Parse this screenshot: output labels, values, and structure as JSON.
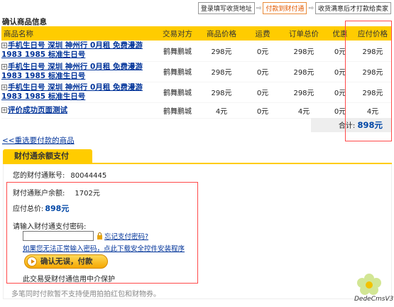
{
  "steps": [
    "登录填写收货地址",
    "付款到财付通",
    "收货满意后才打款给卖家"
  ],
  "step_arrow": "⇨",
  "page_title": "确认商品信息",
  "table": {
    "headers": [
      "商品名称",
      "交易对方",
      "商品价格",
      "运费",
      "订单总价",
      "优惠",
      "应付价格"
    ],
    "rows": [
      {
        "name": "手机生日号 深圳 神州行 0月租 免费漫游 1983 1985 标准生日号",
        "seller": "鹤舞鹏城",
        "price": "298元",
        "shipping": "0元",
        "total": "298元",
        "discount": "0元",
        "due": "298元"
      },
      {
        "name": "手机生日号 深圳 神州行 0月租 免费漫游 1983 1985 标准生日号",
        "seller": "鹤舞鹏城",
        "price": "298元",
        "shipping": "0元",
        "total": "298元",
        "discount": "0元",
        "due": "298元"
      },
      {
        "name": "手机生日号 深圳 神州行 0月租 免费漫游 1983 1985 标准生日号",
        "seller": "鹤舞鹏城",
        "price": "298元",
        "shipping": "0元",
        "total": "298元",
        "discount": "0元",
        "due": "298元"
      },
      {
        "name": "评价成功页面测试",
        "seller": "鹤舞鹏城",
        "price": "4元",
        "shipping": "0元",
        "total": "4元",
        "discount": "0元",
        "due": "4元"
      }
    ],
    "expand_glyph": "+"
  },
  "total": {
    "label": "合计:",
    "value": "898元"
  },
  "back_link": "<<重选要付款的商品",
  "pay": {
    "tab": "财付通余额支付",
    "account_label": "您的财付通账号:",
    "account_value": "80044445",
    "balance_label": "财付通账户余额:",
    "balance_value": "1702元",
    "due_label": "应付总价:",
    "due_value": "898元",
    "password_label": "请输入财付通支付密码:",
    "forgot_link": "忘记支付密码?",
    "control_link": "如果您无法正常输入密码，点此下载安全控件安装程序",
    "confirm_button": "确认无误，付款",
    "protect_text": "此交易受财付通信用中介保护",
    "note": "多笔同时付款暂不支持使用拍拍红包和财物券。"
  },
  "watermark": "DedeCmsV3",
  "colors": {
    "accent": "#ffcc00",
    "link": "#003399",
    "highlight": "#ff4a4a",
    "amount": "#0047a6"
  }
}
